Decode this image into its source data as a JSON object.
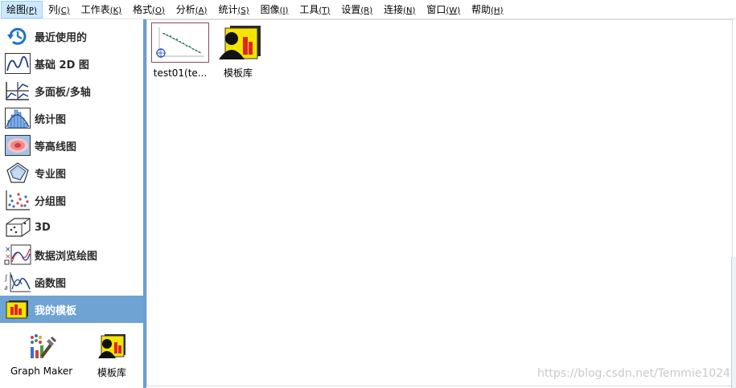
{
  "menubar": {
    "items": [
      {
        "label": "绘图",
        "acc": "(P)"
      },
      {
        "label": "列",
        "acc": "(C)"
      },
      {
        "label": "工作表",
        "acc": "(K)"
      },
      {
        "label": "格式",
        "acc": "(O)"
      },
      {
        "label": "分析",
        "acc": "(A)"
      },
      {
        "label": "统计",
        "acc": "(S)"
      },
      {
        "label": "图像",
        "acc": "(I)"
      },
      {
        "label": "工具",
        "acc": "(T)"
      },
      {
        "label": "设置",
        "acc": "(R)"
      },
      {
        "label": "连接",
        "acc": "(N)"
      },
      {
        "label": "窗口",
        "acc": "(W)"
      },
      {
        "label": "帮助",
        "acc": "(H)"
      }
    ]
  },
  "sidebar": {
    "categories": [
      {
        "label": "最近使用的",
        "icon": "recent-icon"
      },
      {
        "label": "基础 2D 图",
        "icon": "line-2d-icon"
      },
      {
        "label": "多面板/多轴",
        "icon": "multipanel-icon"
      },
      {
        "label": "统计图",
        "icon": "histogram-icon"
      },
      {
        "label": "等高线图",
        "icon": "contour-icon"
      },
      {
        "label": "专业图",
        "icon": "radar-icon"
      },
      {
        "label": "分组图",
        "icon": "grouped-scatter-icon"
      },
      {
        "label": "3D",
        "icon": "cube-3d-icon"
      },
      {
        "label": "数据浏览绘图",
        "icon": "data-explore-icon"
      },
      {
        "label": "函数图",
        "icon": "function-icon"
      },
      {
        "label": "我的模板",
        "icon": "my-template-icon"
      }
    ],
    "selected_index": 10,
    "tools": [
      {
        "label": "Graph Maker",
        "icon": "graph-maker-icon"
      },
      {
        "label": "模板库",
        "icon": "template-library-icon"
      }
    ]
  },
  "main": {
    "items": [
      {
        "label": "test01(te...",
        "icon": "scatter-thumbnail-icon"
      },
      {
        "label": "模板库",
        "icon": "template-library-icon"
      }
    ]
  },
  "watermark": "https://blog.csdn.net/Temmie1024"
}
